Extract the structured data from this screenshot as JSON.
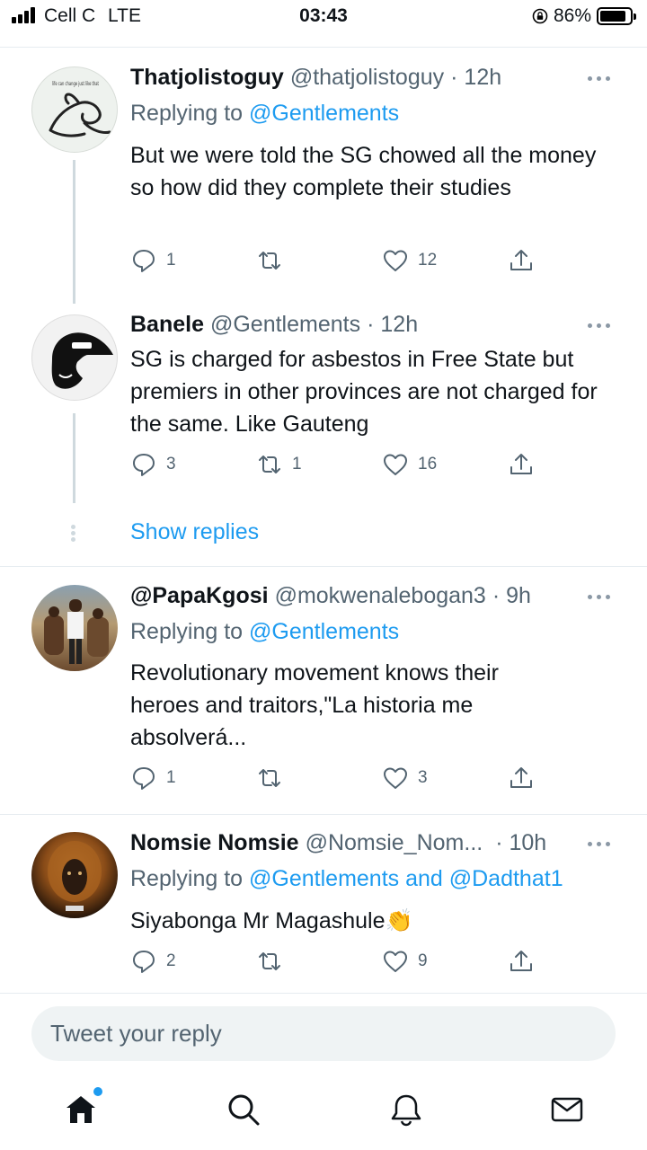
{
  "status_bar": {
    "carrier": "Cell C",
    "network": "LTE",
    "time": "03:43",
    "battery_percent": "86%",
    "battery_level": 0.86
  },
  "tweets": [
    {
      "name": "Thatjolistoguy",
      "handle": "@thatjolistoguy",
      "time": "· 12h",
      "replying_prefix": "Replying to ",
      "replying_to": "@Gentlements",
      "avatar_text": "life can change just like that",
      "text": "But we were told the SG chowed all the money so how did they complete their studies",
      "replies": "1",
      "retweets": "",
      "likes": "12"
    },
    {
      "name": "Banele",
      "handle": "@Gentlements",
      "time": "· 12h",
      "text": "SG is charged for asbestos in Free State but premiers in other provinces are not charged for the same. Like Gauteng",
      "replies": "3",
      "retweets": "1",
      "likes": "16"
    },
    {
      "name": "@PapaKgosi",
      "handle": "@mokwenalebogan3",
      "time": "· 9h",
      "replying_prefix": "Replying to ",
      "replying_to": "@Gentlements",
      "text": "Revolutionary movement knows their heroes and traitors,\"La historia me absolverá...",
      "replies": "1",
      "retweets": "",
      "likes": "3"
    },
    {
      "name": "Nomsie Nomsie",
      "handle": "@Nomsie_Nom...",
      "time": "· 10h",
      "replying_prefix": "Replying to ",
      "replying_to": "@Gentlements and @Dadthat1",
      "text": "Siyabonga Mr Magashule👏",
      "replies": "2",
      "retweets": "",
      "likes": "9"
    }
  ],
  "show_replies": "Show replies",
  "composer": {
    "placeholder": "Tweet your reply"
  },
  "nav": {
    "home": "home-icon",
    "search": "search-icon",
    "notifications": "bell-icon",
    "messages": "mail-icon"
  },
  "colors": {
    "accent": "#1d9bf0",
    "secondary_text": "#536471",
    "divider": "#e6ecf0"
  }
}
